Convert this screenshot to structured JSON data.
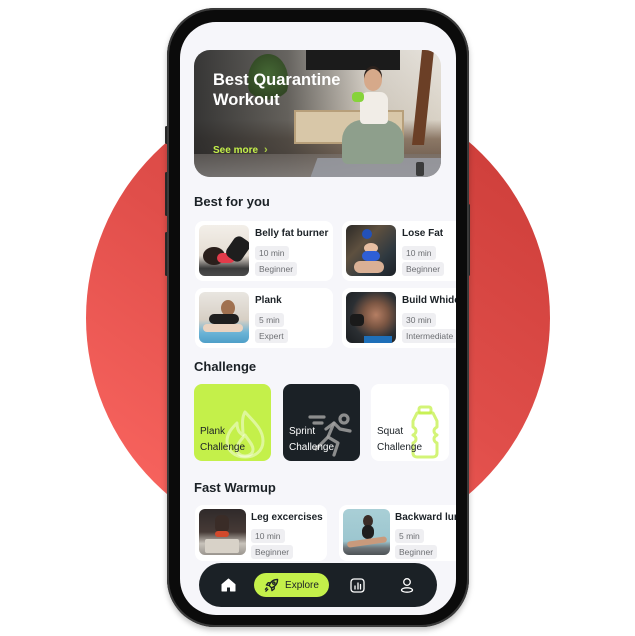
{
  "colors": {
    "accent": "#c4f04a",
    "dark": "#1b2126",
    "background": "#f6f6fa",
    "circle": "#e04e4a"
  },
  "hero": {
    "title": "Best Quarantine Workout",
    "link_label": "See more",
    "link_icon": "chevron-right-icon"
  },
  "best_for_you": {
    "title": "Best for you",
    "items": [
      {
        "title": "Belly fat burner",
        "duration": "10 min",
        "level": "Beginner"
      },
      {
        "title": "Lose Fat",
        "duration": "10 min",
        "level": "Beginner"
      },
      {
        "title": "Plank",
        "duration": "5 min",
        "level": "Expert"
      },
      {
        "title": "Build Whider",
        "duration": "30 min",
        "level": "Intermediate"
      }
    ]
  },
  "challenge": {
    "title": "Challenge",
    "items": [
      {
        "label": "Plank Challenge",
        "icon": "flame-icon"
      },
      {
        "label": "Sprint Challenge",
        "icon": "running-icon"
      },
      {
        "label": "Squat Challenge",
        "icon": "water-bottle-icon"
      }
    ]
  },
  "fast_warmup": {
    "title": "Fast Warmup",
    "items": [
      {
        "title": "Leg excercises",
        "duration": "10 min",
        "level": "Beginner"
      },
      {
        "title": "Backward lunge",
        "duration": "5 min",
        "level": "Beginner"
      }
    ]
  },
  "nav": {
    "items": [
      {
        "id": "home",
        "icon": "home-icon"
      },
      {
        "id": "explore",
        "icon": "rocket-icon",
        "label": "Explore",
        "active": true
      },
      {
        "id": "stats",
        "icon": "bar-chart-icon"
      },
      {
        "id": "profile",
        "icon": "user-icon"
      }
    ]
  }
}
